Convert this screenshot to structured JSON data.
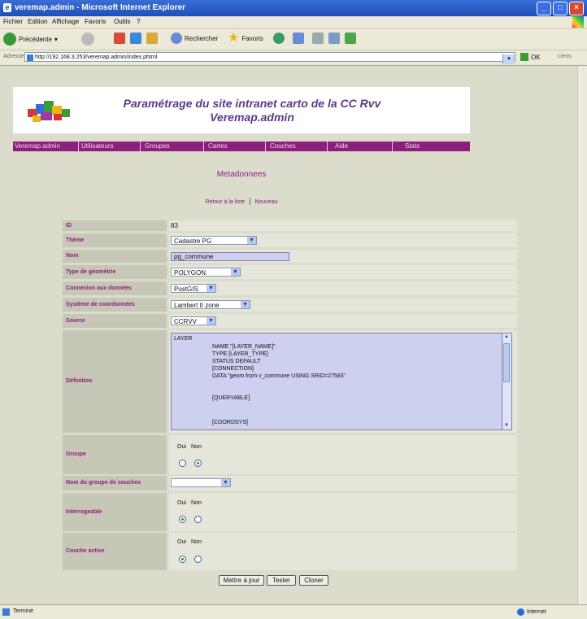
{
  "window": {
    "title": "veremap.admin - Microsoft Internet Explorer"
  },
  "menu": [
    "Fichier",
    "Edition",
    "Affichage",
    "Favoris",
    "Outils",
    "?"
  ],
  "toolbar": {
    "back": "Précédente",
    "search": "Rechercher",
    "favorites": "Favoris"
  },
  "address": {
    "label": "Adresse",
    "url": "http://192.168.3.253/veremap.admin/index.phtml",
    "go": "OK",
    "links": "Liens"
  },
  "site": {
    "title_line1": "Paramétrage du site intranet carto de la CC Rvv",
    "title_line2": "Veremap.admin"
  },
  "nav": [
    "Veremap.admin",
    "Utilisateurs",
    "Groupes",
    "Cartes",
    "Couches",
    "Aide",
    "Stats"
  ],
  "section": {
    "title": "Metadonnees",
    "back_link": "Retour à la liste",
    "new_link": "Nouveau"
  },
  "form": {
    "id": {
      "label": "ID",
      "value": "83"
    },
    "theme": {
      "label": "Thème",
      "value": "Cadastre PG"
    },
    "name": {
      "label": "Nom",
      "value": "pg_commune"
    },
    "geometry": {
      "label": "Type de géométrie",
      "value": "POLYGON"
    },
    "connection": {
      "label": "Connexion aux données",
      "value": "PostGIS"
    },
    "coord_system": {
      "label": "Système de coordonnées",
      "value": "Lambert II zone"
    },
    "source": {
      "label": "Source",
      "value": "CCRVV"
    },
    "definition": {
      "label": "Définition",
      "lines": [
        "LAYER",
        "NAME \"[LAYER_NAME]\"",
        "TYPE [LAYER_TYPE]",
        "STATUS DEFAULT",
        "[CONNECTION]",
        "DATA \"geom from v_commune USING SRID=27583\"",
        "",
        "[QUERYABLE]",
        "",
        "[COORDSYS]"
      ]
    },
    "group": {
      "label": "Groupe",
      "yes": "Oui",
      "no": "Non",
      "selected": "Non"
    },
    "group_name": {
      "label": "Nom du groupe de couches",
      "value": ""
    },
    "queryable": {
      "label": "Interrogeable",
      "yes": "Oui",
      "no": "Non",
      "selected": "Oui"
    },
    "active_layer": {
      "label": "Couche active",
      "yes": "Oui",
      "no": "Non",
      "selected": "Oui"
    }
  },
  "buttons": {
    "update": "Mettre à jour",
    "test": "Tester",
    "clone": "Cloner"
  },
  "status": {
    "left": "Terminé",
    "right": "Internet"
  },
  "colors": {
    "accent": "#8b1f7c",
    "title_text": "#5a3a8a",
    "titlebar": "#1f4fb6"
  }
}
